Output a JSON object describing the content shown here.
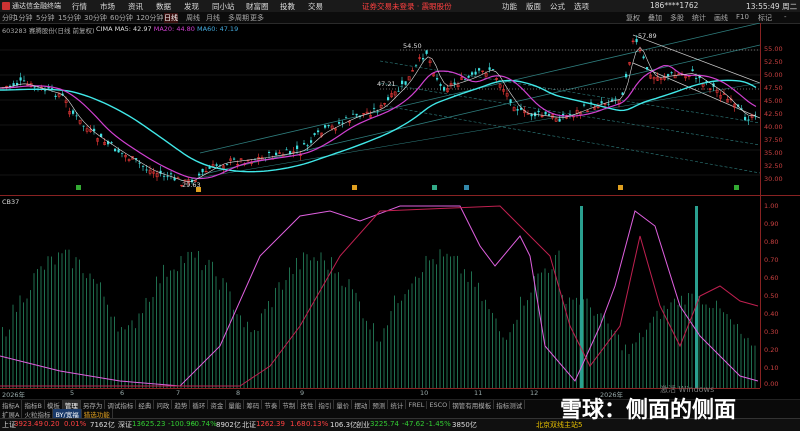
{
  "app": {
    "brand": "通达信金融终端"
  },
  "menu": {
    "items": [
      "行情",
      "市场",
      "资讯",
      "数据",
      "发现",
      "同小站",
      "财富圈",
      "投教",
      "交易"
    ],
    "notice": "证券交易未登录 · 震眼股份",
    "right_items": [
      "功能",
      "版面",
      "公式",
      "选项"
    ],
    "account": "186****1762",
    "clock": "13:55:49 周二"
  },
  "periods": [
    "分时",
    "1分钟",
    "5分钟",
    "15分钟",
    "30分钟",
    "60分钟",
    "120分钟",
    "日线",
    "周线",
    "月线",
    "多周期",
    "更多"
  ],
  "toolbar_right": [
    "复权",
    "叠加",
    "多股",
    "统计",
    "画线",
    "F10",
    "标记",
    "-"
  ],
  "stock": {
    "code": "603283",
    "name": "赛腾股份(日线 前复权)"
  },
  "legend_top": {
    "name": "CIMA",
    "ma5_label": "MA5: 42.97",
    "ma20_label": "MA20: 44.80",
    "ma60_label": "MA60: 47.19"
  },
  "annotations": {
    "high1": "54.50",
    "level1": "47.21",
    "low1": "29.63",
    "high2": "57.89"
  },
  "price_ticks": [
    "55.00",
    "52.50",
    "50.00",
    "47.50",
    "45.00",
    "42.50",
    "40.00",
    "37.50",
    "35.00",
    "32.50",
    "30.00"
  ],
  "indicator": {
    "name": "CB37"
  },
  "indicator_ticks": [
    "1.00",
    "0.90",
    "0.80",
    "0.70",
    "0.60",
    "0.50",
    "0.40",
    "0.30",
    "0.20",
    "0.10",
    "0.00"
  ],
  "x_labels": [
    "2026年",
    "5",
    "6",
    "7",
    "8",
    "9",
    "10",
    "11",
    "12",
    "2026年"
  ],
  "tabs_row1": [
    "指标A",
    "指标B",
    "模板",
    "管理",
    "另存为",
    "调试指标",
    "经典",
    "问政",
    "趋势",
    "循环",
    "资金",
    "量能",
    "筹码",
    "节奏",
    "节制",
    "技性",
    "指引",
    "量价",
    "摆动",
    "预测",
    "统计",
    "FREL",
    "ESCO",
    "钢管有用模板",
    "指标测试"
  ],
  "tabs_row2": [
    "扩展A",
    "火粒指标",
    "BY/宽福",
    "猎选功能"
  ],
  "status": {
    "sh_label": "上证",
    "sh_value": "3923.49",
    "sh_chg": "0.20",
    "sh_pct": "0.01%",
    "sh_amt": "7162亿",
    "sz_label": "深证",
    "sz_value": "13625.23",
    "sz_chg": "-100.96",
    "sz_pct": "-0.74%",
    "sz_amt": "8902亿",
    "bz_label": "北证",
    "bz_value": "1262.39",
    "bz_chg": "1.68",
    "bz_pct": "0.13%",
    "bz_amt": "106.3亿",
    "cy_label": "创业",
    "cy_value": "3225.74",
    "cy_chg": "-47.62",
    "cy_pct": "-1.45%",
    "cy_amt": "3850亿",
    "server": "北京双线主站5"
  },
  "watermark": "雪球：侧面的侧面",
  "win_hint": "激活 Windows"
}
